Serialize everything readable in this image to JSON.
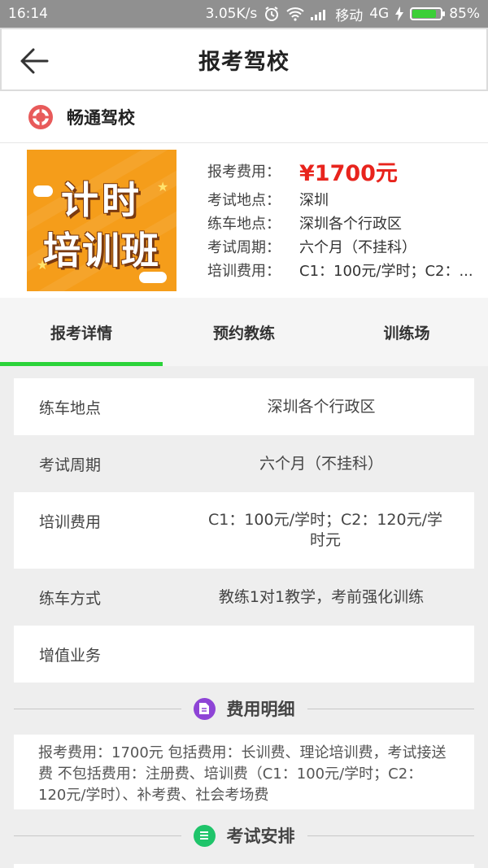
{
  "status_bar": {
    "time": "16:14",
    "network_speed": "3.05K/s",
    "carrier": "移动",
    "network_type": "4G",
    "battery": "85%",
    "battery_level": 0.85
  },
  "header": {
    "title": "报考驾校"
  },
  "school": {
    "name": "畅通驾校"
  },
  "poster": {
    "line1": "计时",
    "line2": "培训班"
  },
  "info": {
    "fee_label": "报考费用：",
    "fee_value": "¥1700元",
    "exam_place_label": "考试地点：",
    "exam_place_value": "深圳",
    "practice_place_label": "练车地点：",
    "practice_place_value": "深圳各个行政区",
    "exam_cycle_label": "考试周期：",
    "exam_cycle_value": "六个月（不挂科）",
    "training_fee_label": "培训费用：",
    "training_fee_value": "C1：100元/学时；C2：..."
  },
  "tabs": [
    {
      "label": "报考详情",
      "active": true
    },
    {
      "label": "预约教练",
      "active": false
    },
    {
      "label": "训练场",
      "active": false
    }
  ],
  "detail_rows": [
    {
      "key": "练车地点",
      "value": "深圳各个行政区"
    },
    {
      "key": "考试周期",
      "value": "六个月（不挂科）"
    },
    {
      "key": "培训费用",
      "value": "C1：100元/学时；C2：120元/学时元"
    },
    {
      "key": "练车方式",
      "value": "教练1对1教学，考前强化训练"
    },
    {
      "key": "增值业务",
      "value": ""
    }
  ],
  "sections": {
    "fee_detail": {
      "label": "费用明细",
      "icon": "document-icon",
      "color": "#8e44d6"
    },
    "exam_schedule": {
      "label": "考试安排",
      "icon": "list-icon",
      "color": "#1fc46a"
    }
  },
  "fee_notes": "报考费用：1700元 包括费用：长训费、理论培训费，考试接送费 不包括费用：注册费、培训费（C1：100元/学时；C2：120元/学时）、补考费、社会考场费",
  "colors": {
    "accent_green": "#2bd33a",
    "price_red": "#e8241d",
    "logo_red": "#e85a5a"
  }
}
